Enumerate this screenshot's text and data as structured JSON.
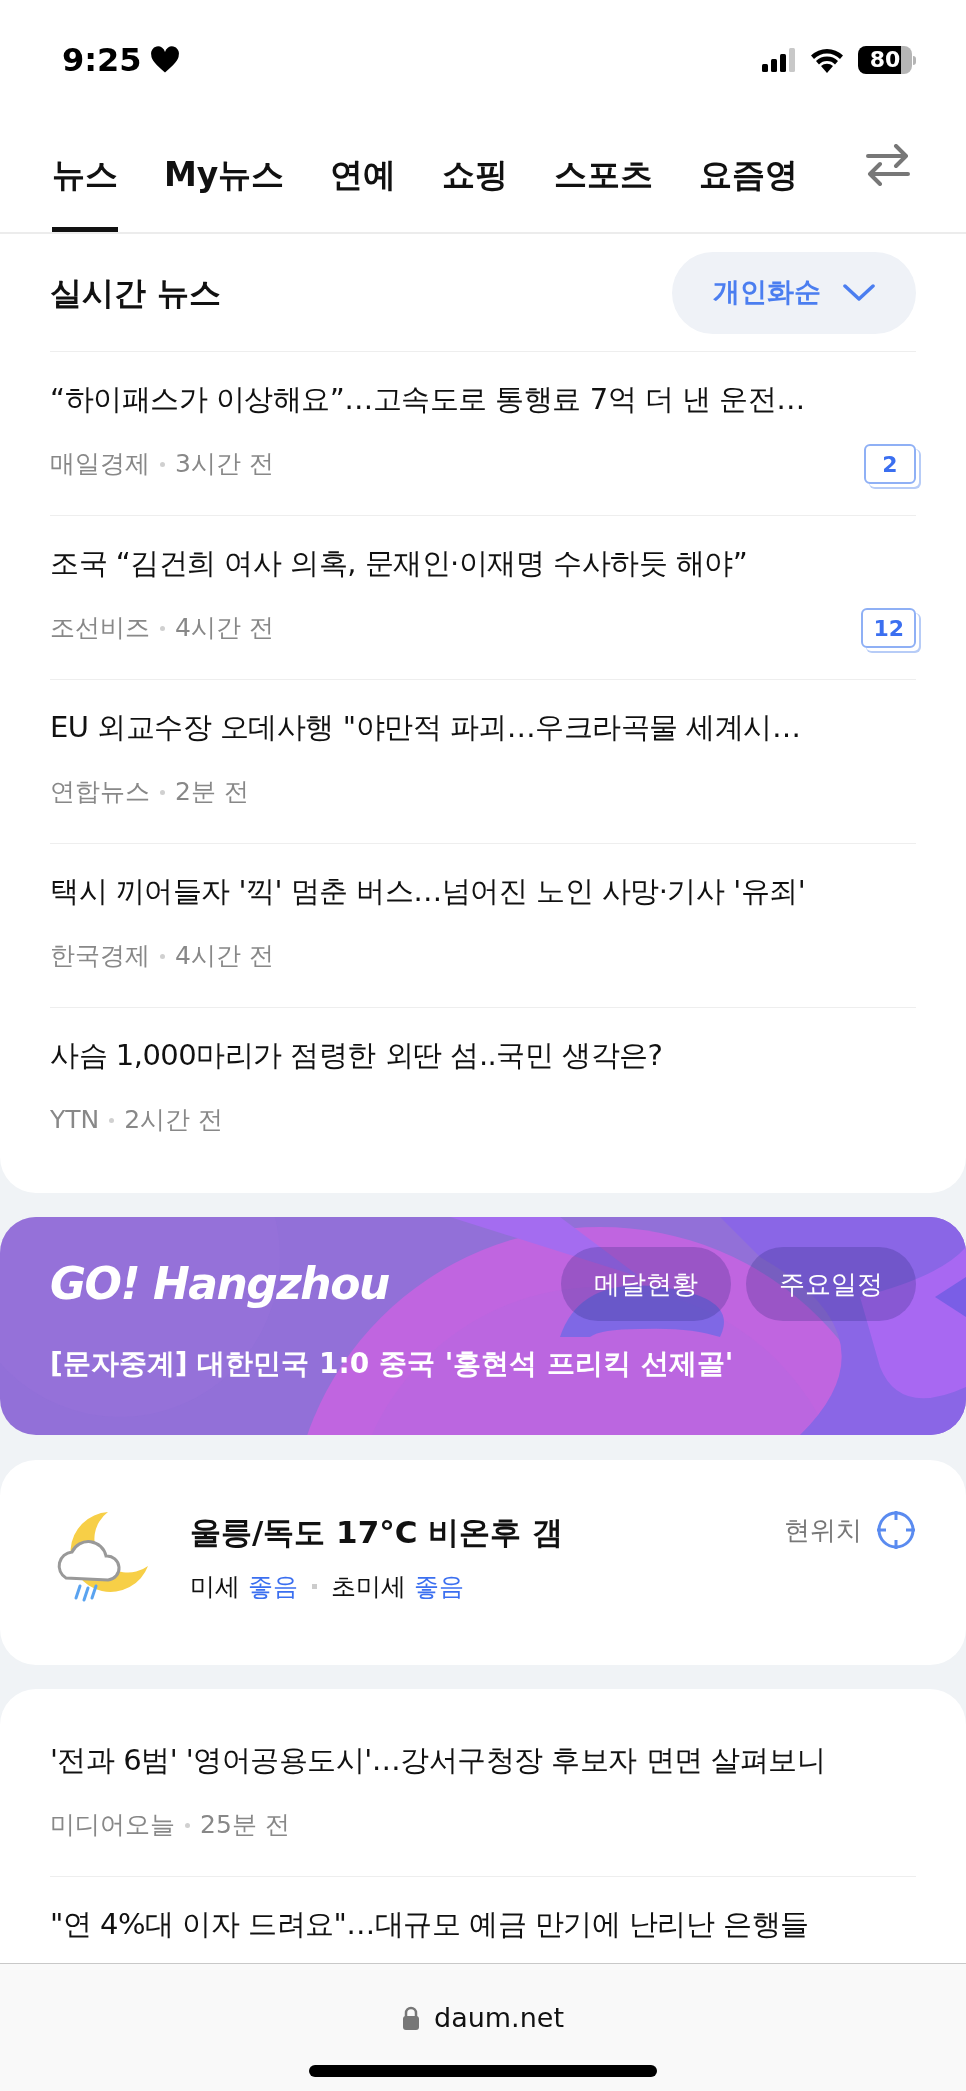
{
  "status_bar": {
    "time": "9:25",
    "battery": "80"
  },
  "tabs": [
    {
      "label": "뉴스",
      "selected": true
    },
    {
      "label": "My뉴스",
      "selected": false
    },
    {
      "label": "연예",
      "selected": false
    },
    {
      "label": "쇼핑",
      "selected": false
    },
    {
      "label": "스포츠",
      "selected": false
    },
    {
      "label": "요즘영",
      "selected": false
    }
  ],
  "section": {
    "title": "실시간 뉴스",
    "sort_button": "개인화순"
  },
  "news": [
    {
      "title": "“하이패스가 이상해요”…고속도로 통행료 7억 더 낸 운전…",
      "source": "매일경제",
      "time": "3시간 전",
      "comments": "2"
    },
    {
      "title": "조국 “김건희 여사 의혹, 문재인·이재명 수사하듯 해야”",
      "source": "조선비즈",
      "time": "4시간 전",
      "comments": "12"
    },
    {
      "title": "EU 외교수장 오데사행 \"야만적 파괴…우크라곡물 세계시…",
      "source": "연합뉴스",
      "time": "2분 전"
    },
    {
      "title": "택시 끼어들자 '끽' 멈춘 버스…넘어진 노인 사망·기사 '유죄'",
      "source": "한국경제",
      "time": "4시간 전"
    },
    {
      "title": "사슴 1,000마리가 점령한 외딴 섬..국민 생각은?",
      "source": "YTN",
      "time": "2시간 전"
    }
  ],
  "banner": {
    "logo": "GO! Hangzhou",
    "buttons": [
      "메달현황",
      "주요일정"
    ],
    "headline": "[문자중계] 대한민국 1:0 중국 '홍현석 프리킥 선제골'"
  },
  "weather": {
    "summary": "울릉/독도 17°C 비온후 갬",
    "dust": [
      {
        "label": "미세",
        "value": "좋음"
      },
      {
        "label": "초미세",
        "value": "좋음"
      }
    ],
    "location_button": "현위치"
  },
  "more_news": [
    {
      "title": "'전과 6범' '영어공용도시'…강서구청장 후보자 면면 살펴보니",
      "source": "미디어오늘",
      "time": "25분 전"
    },
    {
      "title": "\"연 4%대 이자 드려요\"…대규모 예금 만기에 난리난 은행들"
    }
  ],
  "browser": {
    "url": "daum.net"
  }
}
